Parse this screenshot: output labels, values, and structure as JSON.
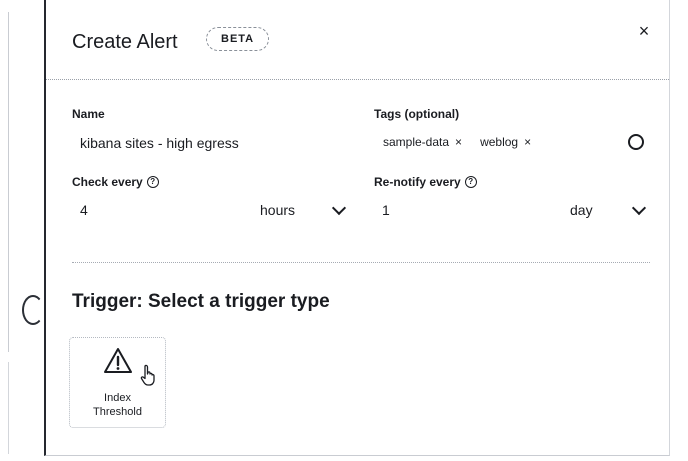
{
  "flyout": {
    "title": "Create Alert",
    "badge": "BETA",
    "close_glyph": "×"
  },
  "form": {
    "name": {
      "label": "Name",
      "value": "kibana sites - high egress"
    },
    "tags": {
      "label": "Tags (optional)",
      "items": [
        {
          "label": "sample-data",
          "remove_glyph": "×"
        },
        {
          "label": "weblog",
          "remove_glyph": "×"
        }
      ]
    },
    "check_every": {
      "label": "Check every",
      "value": "4",
      "unit": "hours"
    },
    "renotify_every": {
      "label": "Re-notify every",
      "value": "1",
      "unit": "day"
    }
  },
  "trigger": {
    "section_title": "Trigger: Select a trigger type",
    "types": [
      {
        "label_line1": "Index",
        "label_line2": "Threshold",
        "icon": "warning-icon"
      }
    ]
  },
  "colors": {
    "text": "#1a1c21",
    "border": "#c9ccd2",
    "accent_dark": "#25282f"
  }
}
